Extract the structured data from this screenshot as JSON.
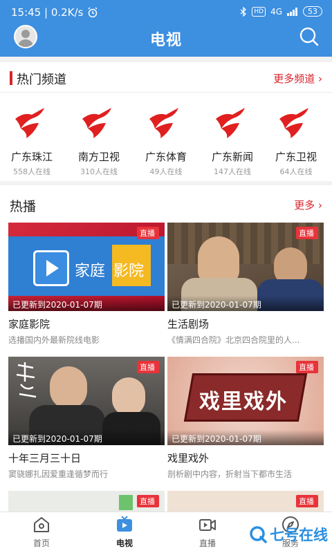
{
  "status_bar": {
    "time_speed": "15:45 | 0.2K/s",
    "signal": "4G",
    "hd": "HD",
    "battery": "53"
  },
  "header": {
    "title": "电视"
  },
  "hot_channels": {
    "title": "热门频道",
    "more": "更多频道 ›",
    "items": [
      {
        "name": "广东珠江",
        "online": "558人在线"
      },
      {
        "name": "南方卫视",
        "online": "310人在线"
      },
      {
        "name": "广东体育",
        "online": "49人在线"
      },
      {
        "name": "广东新闻",
        "online": "147人在线"
      },
      {
        "name": "广东卫视",
        "online": "64人在线"
      }
    ]
  },
  "hot_play": {
    "title": "热播",
    "more": "更多 ›",
    "live_label": "直播",
    "cards": [
      {
        "thumb_text_1": "家庭",
        "thumb_text_2": "影院",
        "update": "已更新到2020-01-07期",
        "title": "家庭影院",
        "desc": "选播国内外最新院线电影"
      },
      {
        "update": "已更新到2020-01-07期",
        "title": "生活剧场",
        "desc": "《情满四合院》北京四合院里的人..."
      },
      {
        "update": "已更新到2020-01-07期",
        "title": "十年三月三十日",
        "desc": "窦骁娜扎因爱重逢循梦而行"
      },
      {
        "thumb_text": "戏里戏外",
        "update": "已更新到2020-01-07期",
        "title": "戏里戏外",
        "desc": "剖析剧中内容，折射当下都市生活"
      }
    ]
  },
  "tabbar": {
    "items": [
      {
        "label": "首页"
      },
      {
        "label": "电视"
      },
      {
        "label": "直播"
      },
      {
        "label": "服务"
      }
    ]
  },
  "watermark": {
    "text": "七号在线"
  },
  "colors": {
    "header_blue": "#3d8fe0",
    "accent_red": "#d8232a",
    "live_red": "#e8333a"
  }
}
